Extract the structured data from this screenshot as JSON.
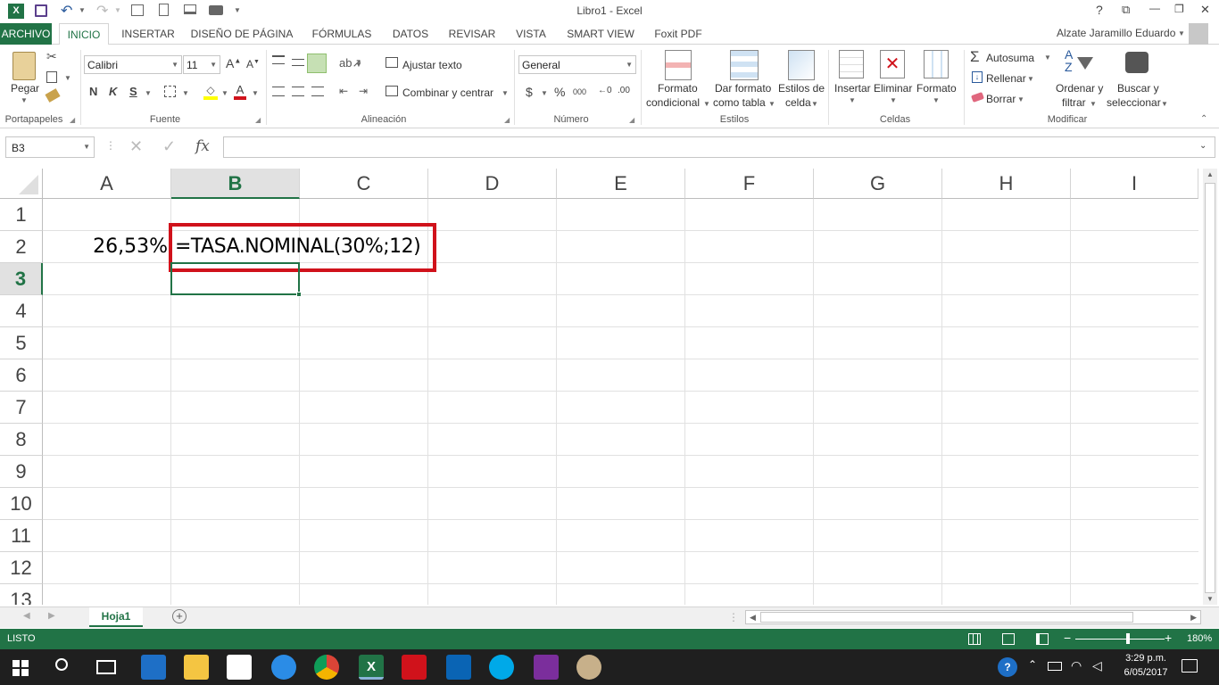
{
  "titlebar": {
    "title": "Libro1 - Excel",
    "help": "?",
    "restore_ribbon": "⧉",
    "minimize": "—",
    "maximize": "❐",
    "close": "✕"
  },
  "tabs": [
    "ARCHIVO",
    "INICIO",
    "INSERTAR",
    "DISEÑO DE PÁGINA",
    "FÓRMULAS",
    "DATOS",
    "REVISAR",
    "VISTA",
    "SMART VIEW",
    "Foxit PDF"
  ],
  "user": "Alzate Jaramillo Eduardo",
  "ribbon": {
    "portapapeles": {
      "paste": "Pegar",
      "label": "Portapapeles"
    },
    "fuente": {
      "font": "Calibri",
      "size": "11",
      "bold": "N",
      "italic": "K",
      "underline": "S",
      "label": "Fuente"
    },
    "alineacion": {
      "wrap": "Ajustar texto",
      "merge": "Combinar y centrar",
      "label": "Alineación"
    },
    "numero": {
      "format": "General",
      "currency": "$",
      "percent": "%",
      "thousands": "000",
      "label": "Número"
    },
    "estilos": {
      "cond1": "Formato",
      "cond2": "condicional",
      "table1": "Dar formato",
      "table2": "como tabla",
      "cell1": "Estilos de",
      "cell2": "celda",
      "label": "Estilos"
    },
    "celdas": {
      "insert": "Insertar",
      "delete": "Eliminar",
      "format": "Formato",
      "label": "Celdas"
    },
    "modificar": {
      "autosum": "Autosuma",
      "fill": "Rellenar",
      "clear": "Borrar",
      "sort1": "Ordenar y",
      "sort2": "filtrar",
      "find1": "Buscar y",
      "find2": "seleccionar",
      "label": "Modificar"
    }
  },
  "formula_bar": {
    "name_box": "B3",
    "fx": "fx",
    "value": ""
  },
  "columns": [
    "A",
    "B",
    "C",
    "D",
    "E",
    "F",
    "G",
    "H",
    "I"
  ],
  "rows": [
    "1",
    "2",
    "3",
    "4",
    "5",
    "6",
    "7",
    "8",
    "9",
    "10",
    "11",
    "12",
    "13"
  ],
  "cells": {
    "A2": "26,53%",
    "B2": "=TASA.NOMINAL(30%;12)"
  },
  "selected_cell": "B3",
  "annotation_color": "#d0121b",
  "sheets": [
    "Hoja1"
  ],
  "status": {
    "mode": "LISTO",
    "zoom": "180%"
  },
  "taskbar": {
    "time": "3:29 p.m.",
    "date": "6/05/2017"
  },
  "accent": "#217346"
}
